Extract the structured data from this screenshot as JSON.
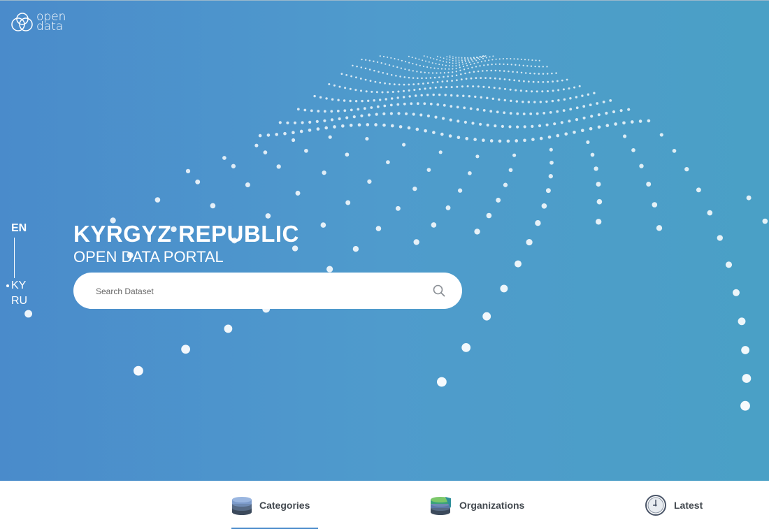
{
  "brand": {
    "logo_line1": "open",
    "logo_line2": "data"
  },
  "languages": {
    "items": [
      "EN",
      "KY",
      "RU"
    ],
    "active": "EN"
  },
  "hero": {
    "title": "KYRGYZ REPUBLIC",
    "subtitle": "OPEN DATA PORTAL"
  },
  "search": {
    "placeholder": "Search Dataset",
    "value": ""
  },
  "nav": {
    "items": [
      {
        "label": "Categories",
        "icon": "database-stack-icon",
        "active": true
      },
      {
        "label": "Organizations",
        "icon": "colored-database-stack-icon",
        "active": false
      },
      {
        "label": "Latest",
        "icon": "clock-icon",
        "active": false
      }
    ]
  },
  "colors": {
    "hero_start": "#4a8bcb",
    "hero_end": "#4aa0c6",
    "nav_text": "#444a50",
    "accent": "#4a8bcb"
  }
}
